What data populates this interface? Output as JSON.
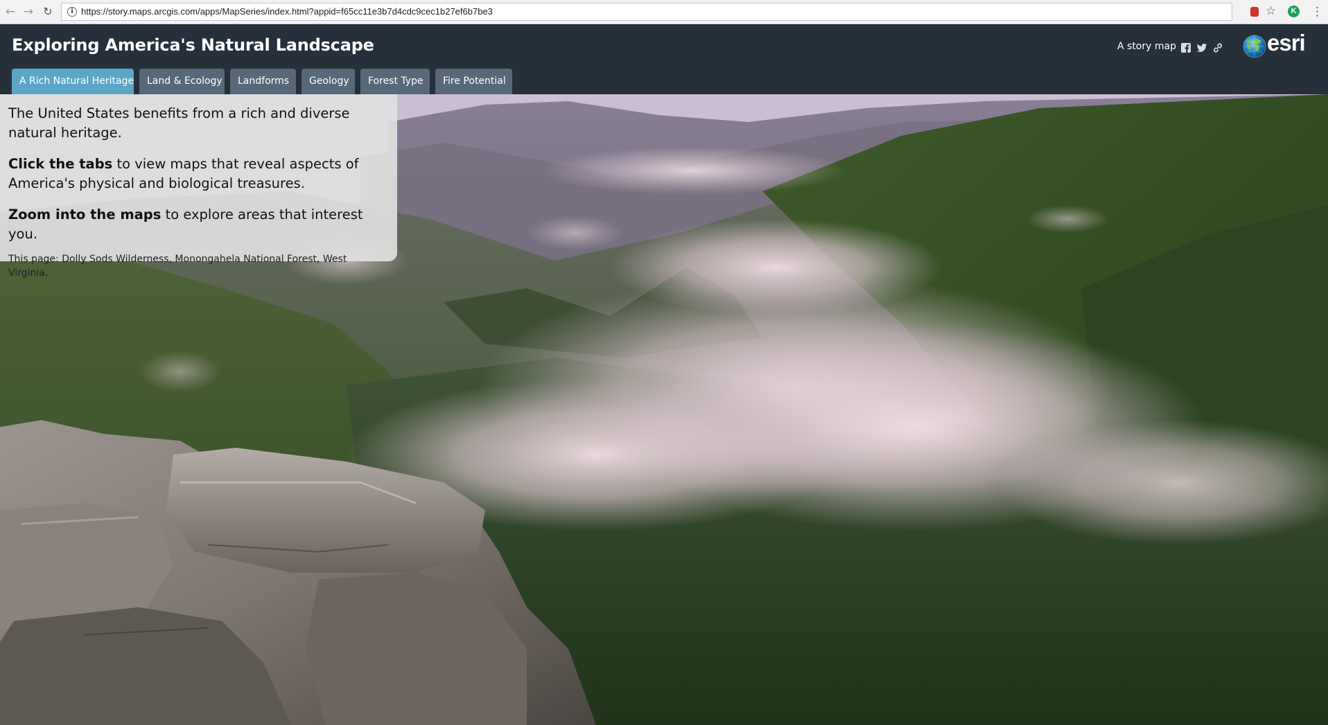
{
  "browser": {
    "url": "https://story.maps.arcgis.com/apps/MapSeries/index.html?appid=f65cc11e3b7d4cdc9cec1b27ef6b7be3",
    "back_icon": "arrow-left",
    "forward_icon": "arrow-right",
    "reload_icon": "reload",
    "extension_letter": "K"
  },
  "header": {
    "title": "Exploring America's Natural Landscape",
    "story_map_label": "A story map",
    "brand": "esri",
    "social_icons": [
      "facebook-icon",
      "twitter-icon",
      "link-icon"
    ]
  },
  "tabs": [
    {
      "label": "A Rich Natural Heritage",
      "active": true
    },
    {
      "label": "Land & Ecology",
      "active": false
    },
    {
      "label": "Landforms",
      "active": false
    },
    {
      "label": "Geology",
      "active": false
    },
    {
      "label": "Forest Type",
      "active": false
    },
    {
      "label": "Fire Potential",
      "active": false
    }
  ],
  "panel": {
    "intro": "The United States benefits from a rich and diverse natural heritage.",
    "tabs_bold": "Click the tabs",
    "tabs_rest": " to view maps that reveal aspects of America's physical and biological treasures.",
    "zoom_bold": "Zoom into the maps",
    "zoom_rest": " to explore areas that interest you.",
    "caption": "This page: Dolly Sods Wilderness, Monongahela National Forest, West Virginia."
  },
  "colors": {
    "header_bg": "#25303b",
    "tab_bg": "#56687a",
    "tab_active_bg": "#5ba6c6",
    "panel_bg": "#e0e0e0"
  }
}
